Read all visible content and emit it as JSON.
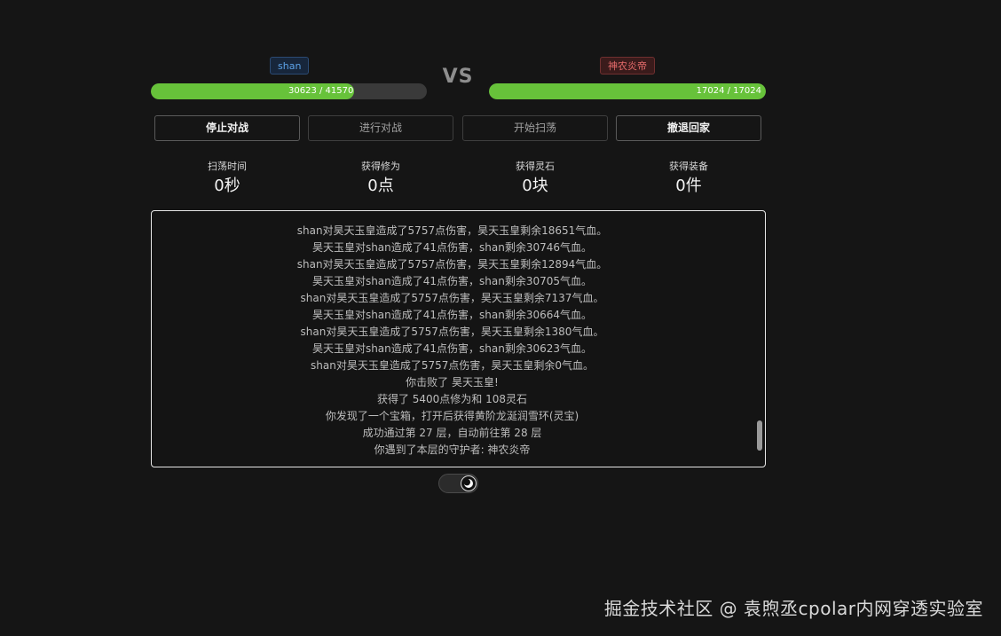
{
  "player": {
    "name": "shan",
    "hp_text": "30623 / 41570",
    "hp_fraction": 0.737
  },
  "vs": "VS",
  "enemy": {
    "name": "神农炎帝",
    "hp_text": "17024 / 17024",
    "hp_fraction": 1.0
  },
  "buttons": {
    "stop_battle": "停止对战",
    "start_battle": "进行对战",
    "start_sweep": "开始扫荡",
    "retreat_home": "撤退回家"
  },
  "stats": [
    {
      "label": "扫荡时间",
      "value": "0秒"
    },
    {
      "label": "获得修为",
      "value": "0点"
    },
    {
      "label": "获得灵石",
      "value": "0块"
    },
    {
      "label": "获得装备",
      "value": "0件"
    }
  ],
  "log": [
    "shan对昊天玉皇造成了5757点伤害，昊天玉皇剩余18651气血。",
    "昊天玉皇对shan造成了41点伤害，shan剩余30746气血。",
    "shan对昊天玉皇造成了5757点伤害，昊天玉皇剩余12894气血。",
    "昊天玉皇对shan造成了41点伤害，shan剩余30705气血。",
    "shan对昊天玉皇造成了5757点伤害，昊天玉皇剩余7137气血。",
    "昊天玉皇对shan造成了41点伤害，shan剩余30664气血。",
    "shan对昊天玉皇造成了5757点伤害，昊天玉皇剩余1380气血。",
    "昊天玉皇对shan造成了41点伤害，shan剩余30623气血。",
    "shan对昊天玉皇造成了5757点伤害，昊天玉皇剩余0气血。",
    "你击败了 昊天玉皇!",
    "获得了 5400点修为和 108灵石",
    "你发现了一个宝箱，打开后获得黄阶龙涎润雪环(灵宝)",
    "成功通过第 27 层，自动前往第 28 层",
    "你遇到了本层的守护者: 神农炎帝"
  ],
  "watermark": "掘金技术社区 @ 袁煦丞cpolar内网穿透实验室",
  "colors": {
    "background": "#151515",
    "hp_green": "#67c23a",
    "player_tag": "#5da3e8",
    "enemy_tag": "#e36a6a"
  },
  "icons": {
    "theme_toggle": "moon-icon"
  }
}
